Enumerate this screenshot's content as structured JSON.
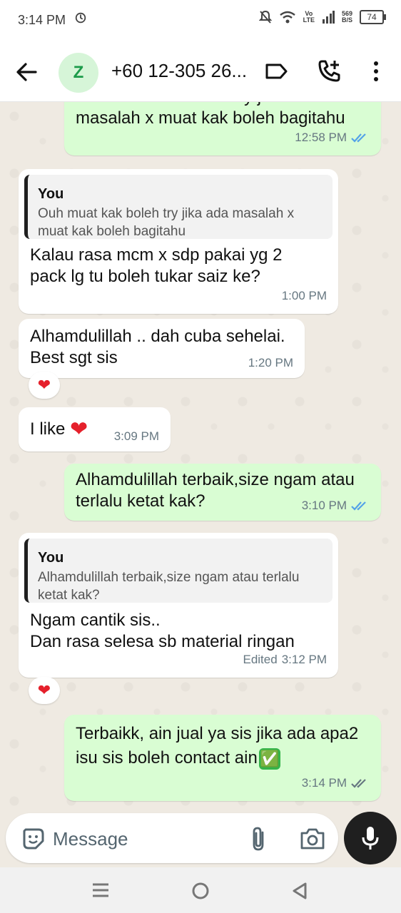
{
  "status_bar": {
    "time": "3:14 PM",
    "network_1": "Vo",
    "network_2": "LTE",
    "speed_value": "569",
    "speed_unit": "B/S",
    "battery": "74"
  },
  "header": {
    "avatar_letter": "Z",
    "contact_name": "+60 12-305 26..."
  },
  "messages": [
    {
      "direction": "outgoing",
      "text_top_partial": "Ouh muat kak boleh try jika ada",
      "text": "masalah x muat kak boleh bagitahu",
      "time": "12:58 PM",
      "status": "read"
    },
    {
      "direction": "incoming",
      "quote_name": "You",
      "quote_text": "Ouh muat kak boleh try jika ada masalah x muat kak boleh bagitahu",
      "text_line1": "Kalau rasa mcm x sdp pakai yg 2",
      "text_line2": "pack lg tu boleh tukar saiz ke?",
      "time": "1:00 PM"
    },
    {
      "direction": "incoming",
      "text_line1": "Alhamdulillah .. dah cuba sehelai.",
      "text_line2": "Best sgt sis",
      "time": "1:20 PM",
      "reaction": "❤"
    },
    {
      "direction": "incoming",
      "text": "I like",
      "emoji": "❤",
      "time": "3:09 PM"
    },
    {
      "direction": "outgoing",
      "text_line1": "Alhamdulillah terbaik,size ngam atau",
      "text_line2": "terlalu ketat kak?",
      "time": "3:10 PM",
      "status": "read"
    },
    {
      "direction": "incoming",
      "quote_name": "You",
      "quote_text": "Alhamdulillah terbaik,size ngam atau terlalu ketat kak?",
      "text_line1": "Ngam cantik sis..",
      "text_line2": "Dan rasa selesa sb material ringan",
      "edited_label": "Edited",
      "time": "3:12 PM",
      "reaction": "❤"
    },
    {
      "direction": "outgoing",
      "text_line1": "Terbaikk, ain jual ya sis jika ada apa2",
      "text_line2": "isu sis boleh contact ain",
      "emoji": "✅",
      "time": "3:14 PM",
      "status": "delivered"
    }
  ],
  "composer": {
    "placeholder": "Message"
  },
  "colors": {
    "outgoing_bubble": "#d9fdd3",
    "incoming_bubble": "#ffffff",
    "read_ticks": "#53a2e8",
    "unread_ticks": "#667781",
    "avatar_bg": "#d6f5d8",
    "avatar_fg": "#1c9b4a"
  },
  "icons": [
    "back-arrow-icon",
    "label-icon",
    "add-call-icon",
    "more-vert-icon",
    "sticker-icon",
    "attach-icon",
    "camera-icon",
    "mic-icon",
    "recents-icon",
    "home-icon",
    "back-nav-icon"
  ]
}
